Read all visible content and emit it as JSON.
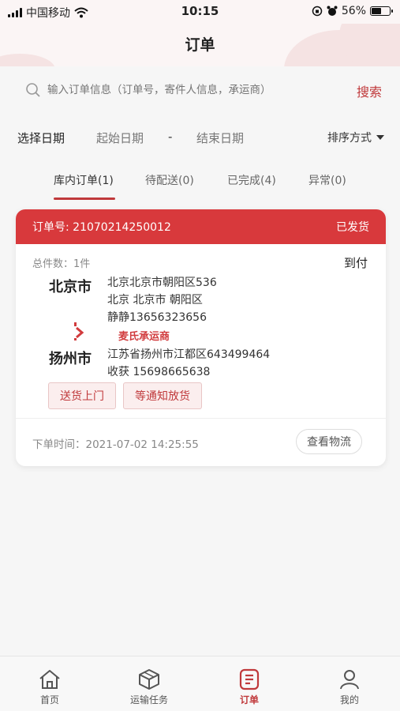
{
  "status_bar": {
    "carrier": "中国移动",
    "time": "10:15",
    "battery": "56%"
  },
  "header": {
    "title": "订单"
  },
  "search": {
    "placeholder": "输入订单信息（订单号，寄件人信息，承运商）",
    "button": "搜索"
  },
  "date_filter": {
    "label": "选择日期",
    "start": "起始日期",
    "dash": "-",
    "end": "结束日期",
    "sort_label": "排序方式"
  },
  "tabs": [
    {
      "label": "库内订单(1)",
      "active": true
    },
    {
      "label": "待配送(0)"
    },
    {
      "label": "已完成(4)"
    },
    {
      "label": "异常(0)"
    }
  ],
  "order": {
    "number_label": "订单号: 21070214250012",
    "status": "已发货",
    "total": "总件数：1件",
    "payment": "到付",
    "from_city": "北京市",
    "from_lines": [
      "北京北京市朝阳区536",
      "北京 北京市 朝阳区",
      "静静13656323656"
    ],
    "carrier": "麦氏承运商",
    "to_city": "扬州市",
    "to_lines": [
      "江苏省扬州市江都区643499464",
      "收获 15698665638"
    ],
    "tags": [
      "送货上门",
      "等通知放货"
    ],
    "order_time": "下单时间：2021-07-02 14:25:55",
    "logistics_button": "查看物流"
  },
  "bottom_nav": [
    {
      "label": "首页",
      "icon": "home-icon"
    },
    {
      "label": "运输任务",
      "icon": "box-icon"
    },
    {
      "label": "订单",
      "icon": "order-icon",
      "active": true
    },
    {
      "label": "我的",
      "icon": "user-icon"
    }
  ],
  "colors": {
    "accent": "#d8393c",
    "background": "#f6f6f6"
  }
}
